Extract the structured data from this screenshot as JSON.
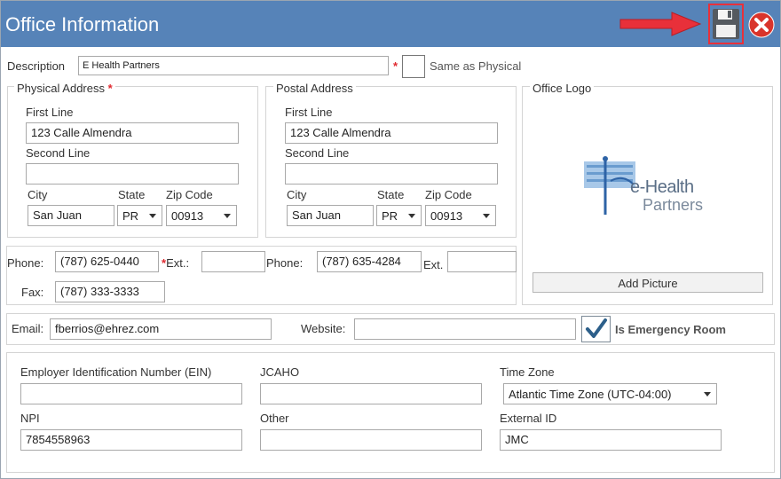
{
  "window": {
    "title": "Office Information"
  },
  "toolbar": {
    "save_icon": "floppy-save-icon",
    "close_icon": "close-x-icon",
    "annotation": "red-arrow-pointing-to-save"
  },
  "description": {
    "label": "Description",
    "value": "E Health Partners",
    "same_as_physical_label": "Same as Physical"
  },
  "physical": {
    "legend": "Physical Address",
    "first_line_label": "First Line",
    "first_line": "123 Calle Almendra",
    "second_line_label": "Second Line",
    "second_line": "",
    "city_label": "City",
    "city": "San Juan",
    "state_label": "State",
    "state": "PR",
    "zip_label": "Zip Code",
    "zip": "00913"
  },
  "postal": {
    "legend": "Postal Address",
    "first_line_label": "First Line",
    "first_line": "123 Calle Almendra",
    "second_line_label": "Second Line",
    "second_line": "",
    "city_label": "City",
    "city": "San Juan",
    "state_label": "State",
    "state": "PR",
    "zip_label": "Zip Code",
    "zip": "00913"
  },
  "logo": {
    "legend": "Office Logo",
    "brand_top": "e-Health",
    "brand_bottom": "Partners",
    "add_picture": "Add Picture"
  },
  "contact": {
    "phone_label": "Phone:",
    "phone1": "(787) 625-0440",
    "ext_label": "Ext.:",
    "ext1": "",
    "phone2_label": "Phone:",
    "phone2": "(787) 635-4284",
    "ext2_label": "Ext.",
    "ext2": "",
    "fax_label": "Fax:",
    "fax": "(787) 333-3333"
  },
  "email": {
    "label": "Email:",
    "value": "fberrios@ehrez.com",
    "website_label": "Website:",
    "website": "",
    "emergency_label": "Is Emergency Room",
    "emergency_checked": true
  },
  "ids": {
    "ein_label": "Employer Identification Number (EIN)",
    "ein": "",
    "jcaho_label": "JCAHO",
    "jcaho": "",
    "timezone_label": "Time Zone",
    "timezone": "Atlantic Time Zone (UTC-04:00)",
    "npi_label": "NPI",
    "npi": "7854558963",
    "other_label": "Other",
    "other": "",
    "external_id_label": "External ID",
    "external_id": "JMC"
  },
  "colors": {
    "titlebar": "#5683b8",
    "required": "#e0282e",
    "highlight": "#e8303a",
    "check": "#2c5f8a"
  }
}
